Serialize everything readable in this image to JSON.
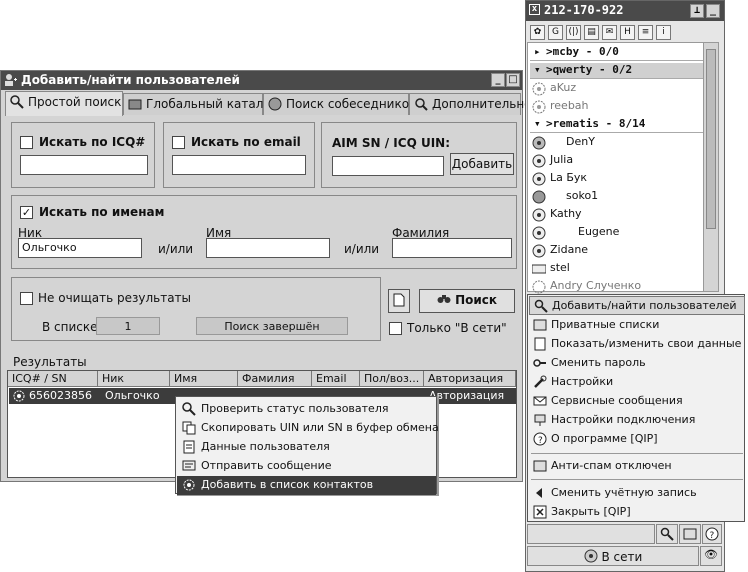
{
  "search_window": {
    "title": "Добавить/найти пользователей",
    "tabs": [
      "Простой поиск",
      "Глобальный каталог",
      "Поиск собеседников",
      "Дополнительно"
    ],
    "icq": {
      "label": "Искать по ICQ#"
    },
    "email": {
      "label": "Искать по email"
    },
    "aim": {
      "label": "AIM SN / ICQ UIN:",
      "add_button": "Добавить"
    },
    "names": {
      "label": "Искать по именам",
      "nick_label": "Ник",
      "nick_value": "Ольгочко",
      "name_label": "Имя",
      "surname_label": "Фамилия",
      "andor": "и/или"
    },
    "options": {
      "no_clear": "Не очищать результаты",
      "in_list_label": "В списке:",
      "in_list_value": "1",
      "status": "Поиск завершён",
      "search_button": "Поиск",
      "online_only": "Только \"В сети\""
    },
    "results": {
      "label": "Результаты",
      "columns": [
        "ICQ# / SN",
        "Ник",
        "Имя",
        "Фамилия",
        "Email",
        "Пол/воз...",
        "Авторизация"
      ],
      "row": {
        "uin": "656023856",
        "nick": "Ольгочко",
        "auth": "Авторизация"
      }
    }
  },
  "context_menu": [
    {
      "label": "Проверить статус пользователя",
      "icon": "search-icon"
    },
    {
      "label": "Скопировать UIN или SN в буфер обмена",
      "icon": "copy-icon"
    },
    {
      "label": "Данные пользователя",
      "icon": "info-icon"
    },
    {
      "label": "Отправить сообщение",
      "icon": "message-icon"
    },
    {
      "label": "Добавить в список контактов",
      "icon": "add-contact-icon"
    }
  ],
  "qip": {
    "title": "212-170-922",
    "groups": [
      {
        "label": ">mcby - 0/0"
      },
      {
        "label": ">qwerty - 0/2"
      },
      {
        "label": ">rematis - 8/14"
      }
    ],
    "contacts_qwerty": [
      "aKuz",
      "reebah"
    ],
    "contacts_rematis": [
      "DenY",
      "Julia",
      "La Бук",
      "soko1",
      "Kathy",
      "Eugene",
      "Zidane",
      "stel",
      "Andry Слученко"
    ],
    "menu": [
      "Добавить/найти пользователей",
      "Приватные списки",
      "Показать/изменить свои данные",
      "Сменить пароль",
      "Настройки",
      "Сервисные сообщения",
      "Настройки подключения",
      "О программе [QIP]",
      "Анти-спам отключен",
      "Сменить учётную запись",
      "Закрыть [QIP]"
    ],
    "status": "В сети"
  }
}
